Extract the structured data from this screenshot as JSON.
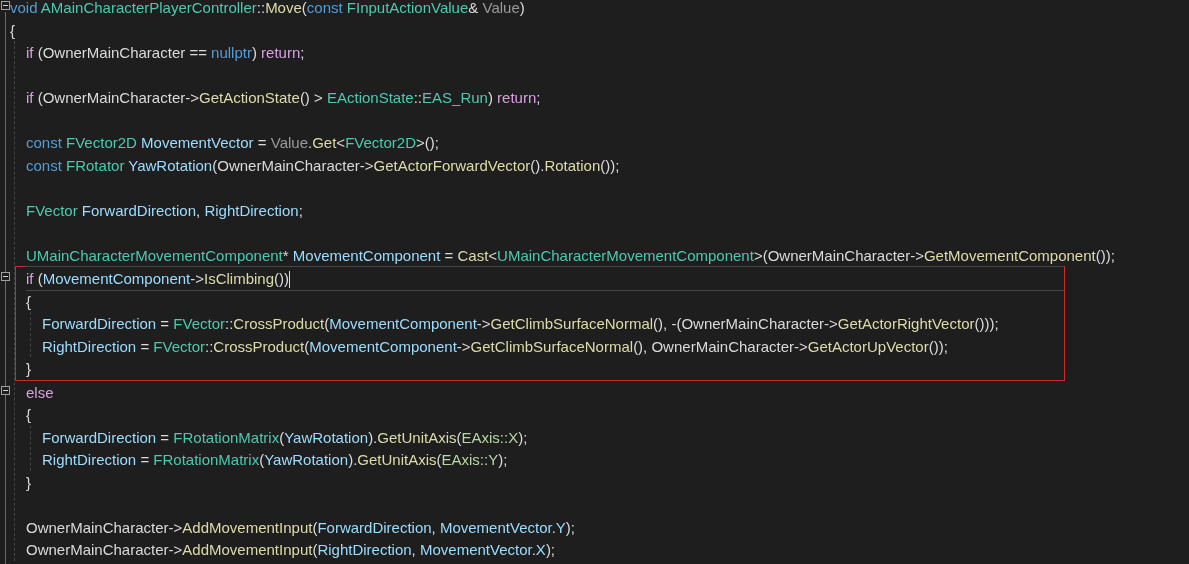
{
  "lines": [
    {
      "kind": "code",
      "expanded": true,
      "tokens": [
        {
          "kind": "keyword",
          "text": "void "
        },
        {
          "kind": "type",
          "text": "AMainCharacterPlayerController"
        },
        {
          "kind": "plain",
          "text": "::"
        },
        {
          "kind": "function",
          "text": "Move"
        },
        {
          "kind": "plain",
          "text": "("
        },
        {
          "kind": "keyword",
          "text": "const "
        },
        {
          "kind": "type",
          "text": "FInputActionValue"
        },
        {
          "kind": "plain",
          "text": "& "
        },
        {
          "kind": "param",
          "text": "Value"
        },
        {
          "kind": "plain",
          "text": ")"
        }
      ]
    },
    {
      "kind": "code",
      "tokens": [
        {
          "kind": "plain",
          "text": "{"
        }
      ],
      "children": [
        {
          "kind": "code",
          "tokens": [
            {
              "kind": "control",
              "text": "if"
            },
            {
              "kind": "plain",
              "text": " (OwnerMainCharacter == "
            },
            {
              "kind": "keyword",
              "text": "nullptr"
            },
            {
              "kind": "plain",
              "text": ") "
            },
            {
              "kind": "control",
              "text": "return"
            },
            {
              "kind": "plain",
              "text": ";"
            }
          ]
        },
        {
          "kind": "blank"
        },
        {
          "kind": "code",
          "tokens": [
            {
              "kind": "control",
              "text": "if"
            },
            {
              "kind": "plain",
              "text": " (OwnerMainCharacter->"
            },
            {
              "kind": "function",
              "text": "GetActionState"
            },
            {
              "kind": "plain",
              "text": "() > "
            },
            {
              "kind": "type",
              "text": "EActionState"
            },
            {
              "kind": "plain",
              "text": "::"
            },
            {
              "kind": "type",
              "text": "EAS_Run"
            },
            {
              "kind": "plain",
              "text": ") "
            },
            {
              "kind": "control",
              "text": "return"
            },
            {
              "kind": "plain",
              "text": ";"
            }
          ]
        },
        {
          "kind": "blank"
        },
        {
          "kind": "code",
          "tokens": [
            {
              "kind": "keyword",
              "text": "const "
            },
            {
              "kind": "type",
              "text": "FVector2D "
            },
            {
              "kind": "variable",
              "text": "MovementVector"
            },
            {
              "kind": "plain",
              "text": " = "
            },
            {
              "kind": "param",
              "text": "Value"
            },
            {
              "kind": "plain",
              "text": "."
            },
            {
              "kind": "function",
              "text": "Get"
            },
            {
              "kind": "plain",
              "text": "<"
            },
            {
              "kind": "type",
              "text": "FVector2D"
            },
            {
              "kind": "plain",
              "text": ">();"
            }
          ]
        },
        {
          "kind": "code",
          "tokens": [
            {
              "kind": "keyword",
              "text": "const "
            },
            {
              "kind": "type",
              "text": "FRotator "
            },
            {
              "kind": "variable",
              "text": "YawRotation"
            },
            {
              "kind": "plain",
              "text": "(OwnerMainCharacter->"
            },
            {
              "kind": "function",
              "text": "GetActorForwardVector"
            },
            {
              "kind": "plain",
              "text": "()."
            },
            {
              "kind": "function",
              "text": "Rotation"
            },
            {
              "kind": "plain",
              "text": "());"
            }
          ]
        },
        {
          "kind": "blank"
        },
        {
          "kind": "code",
          "tokens": [
            {
              "kind": "type",
              "text": "FVector "
            },
            {
              "kind": "variable",
              "text": "ForwardDirection"
            },
            {
              "kind": "plain",
              "text": ", "
            },
            {
              "kind": "variable",
              "text": "RightDirection"
            },
            {
              "kind": "plain",
              "text": ";"
            }
          ]
        },
        {
          "kind": "blank"
        },
        {
          "kind": "code",
          "tokens": [
            {
              "kind": "type",
              "text": "UMainCharacterMovementComponent"
            },
            {
              "kind": "plain",
              "text": "* "
            },
            {
              "kind": "variable",
              "text": "MovementComponent"
            },
            {
              "kind": "plain",
              "text": " = "
            },
            {
              "kind": "function",
              "text": "Cast"
            },
            {
              "kind": "plain",
              "text": "<"
            },
            {
              "kind": "type",
              "text": "UMainCharacterMovementComponent"
            },
            {
              "kind": "plain",
              "text": ">(OwnerMainCharacter->"
            },
            {
              "kind": "function",
              "text": "GetMovementComponent"
            },
            {
              "kind": "plain",
              "text": "());"
            }
          ]
        },
        {
          "kind": "region",
          "outlined": true,
          "children": [
            {
              "kind": "code",
              "expanded": true,
              "current": true,
              "tokens": [
                {
                  "kind": "control",
                  "text": "if"
                },
                {
                  "kind": "plain",
                  "text": " ("
                },
                {
                  "kind": "variable",
                  "text": "MovementComponent"
                },
                {
                  "kind": "plain",
                  "text": "->"
                },
                {
                  "kind": "function",
                  "text": "IsClimbing"
                },
                {
                  "kind": "plain",
                  "text": "())"
                }
              ]
            },
            {
              "kind": "code",
              "tokens": [
                {
                  "kind": "plain",
                  "text": "{"
                }
              ],
              "children": [
                {
                  "kind": "code",
                  "tokens": [
                    {
                      "kind": "variable",
                      "text": "ForwardDirection"
                    },
                    {
                      "kind": "plain",
                      "text": " = "
                    },
                    {
                      "kind": "type",
                      "text": "FVector"
                    },
                    {
                      "kind": "plain",
                      "text": "::"
                    },
                    {
                      "kind": "function",
                      "text": "CrossProduct"
                    },
                    {
                      "kind": "plain",
                      "text": "("
                    },
                    {
                      "kind": "variable",
                      "text": "MovementComponent"
                    },
                    {
                      "kind": "plain",
                      "text": "->"
                    },
                    {
                      "kind": "function",
                      "text": "GetClimbSurfaceNormal"
                    },
                    {
                      "kind": "plain",
                      "text": "(), -(OwnerMainCharacter->"
                    },
                    {
                      "kind": "function",
                      "text": "GetActorRightVector"
                    },
                    {
                      "kind": "plain",
                      "text": "()));"
                    }
                  ]
                },
                {
                  "kind": "code",
                  "tokens": [
                    {
                      "kind": "variable",
                      "text": "RightDirection"
                    },
                    {
                      "kind": "plain",
                      "text": " = "
                    },
                    {
                      "kind": "type",
                      "text": "FVector"
                    },
                    {
                      "kind": "plain",
                      "text": "::"
                    },
                    {
                      "kind": "function",
                      "text": "CrossProduct"
                    },
                    {
                      "kind": "plain",
                      "text": "("
                    },
                    {
                      "kind": "variable",
                      "text": "MovementComponent"
                    },
                    {
                      "kind": "plain",
                      "text": "->"
                    },
                    {
                      "kind": "function",
                      "text": "GetClimbSurfaceNormal"
                    },
                    {
                      "kind": "plain",
                      "text": "(), OwnerMainCharacter->"
                    },
                    {
                      "kind": "function",
                      "text": "GetActorUpVector"
                    },
                    {
                      "kind": "plain",
                      "text": "());"
                    }
                  ]
                }
              ]
            },
            {
              "kind": "code",
              "tokens": [
                {
                  "kind": "plain",
                  "text": "}"
                }
              ]
            }
          ]
        },
        {
          "kind": "code",
          "expanded": true,
          "tokens": [
            {
              "kind": "control",
              "text": "else"
            }
          ]
        },
        {
          "kind": "code",
          "tokens": [
            {
              "kind": "plain",
              "text": "{"
            }
          ],
          "children": [
            {
              "kind": "code",
              "tokens": [
                {
                  "kind": "variable",
                  "text": "ForwardDirection"
                },
                {
                  "kind": "plain",
                  "text": " = "
                },
                {
                  "kind": "type",
                  "text": "FRotationMatrix"
                },
                {
                  "kind": "plain",
                  "text": "("
                },
                {
                  "kind": "variable",
                  "text": "YawRotation"
                },
                {
                  "kind": "plain",
                  "text": ")."
                },
                {
                  "kind": "function",
                  "text": "GetUnitAxis"
                },
                {
                  "kind": "plain",
                  "text": "("
                },
                {
                  "kind": "enum",
                  "text": "EAxis::X"
                },
                {
                  "kind": "plain",
                  "text": ");"
                }
              ]
            },
            {
              "kind": "code",
              "tokens": [
                {
                  "kind": "variable",
                  "text": "RightDirection"
                },
                {
                  "kind": "plain",
                  "text": " = "
                },
                {
                  "kind": "type",
                  "text": "FRotationMatrix"
                },
                {
                  "kind": "plain",
                  "text": "("
                },
                {
                  "kind": "variable",
                  "text": "YawRotation"
                },
                {
                  "kind": "plain",
                  "text": ")."
                },
                {
                  "kind": "function",
                  "text": "GetUnitAxis"
                },
                {
                  "kind": "plain",
                  "text": "("
                },
                {
                  "kind": "enum",
                  "text": "EAxis::Y"
                },
                {
                  "kind": "plain",
                  "text": ");"
                }
              ]
            }
          ]
        },
        {
          "kind": "code",
          "tokens": [
            {
              "kind": "plain",
              "text": "}"
            }
          ]
        },
        {
          "kind": "blank"
        },
        {
          "kind": "code",
          "tokens": [
            {
              "kind": "plain",
              "text": "OwnerMainCharacter->"
            },
            {
              "kind": "function",
              "text": "AddMovementInput"
            },
            {
              "kind": "plain",
              "text": "("
            },
            {
              "kind": "variable",
              "text": "ForwardDirection"
            },
            {
              "kind": "plain",
              "text": ", "
            },
            {
              "kind": "variable",
              "text": "MovementVector"
            },
            {
              "kind": "plain",
              "text": "."
            },
            {
              "kind": "variable",
              "text": "Y"
            },
            {
              "kind": "plain",
              "text": ");"
            }
          ]
        },
        {
          "kind": "code",
          "tokens": [
            {
              "kind": "plain",
              "text": "OwnerMainCharacter->"
            },
            {
              "kind": "function",
              "text": "AddMovementInput"
            },
            {
              "kind": "plain",
              "text": "("
            },
            {
              "kind": "variable",
              "text": "RightDirection"
            },
            {
              "kind": "plain",
              "text": ", "
            },
            {
              "kind": "variable",
              "text": "MovementVector"
            },
            {
              "kind": "plain",
              "text": "."
            },
            {
              "kind": "variable",
              "text": "X"
            },
            {
              "kind": "plain",
              "text": ");"
            }
          ]
        }
      ]
    }
  ]
}
